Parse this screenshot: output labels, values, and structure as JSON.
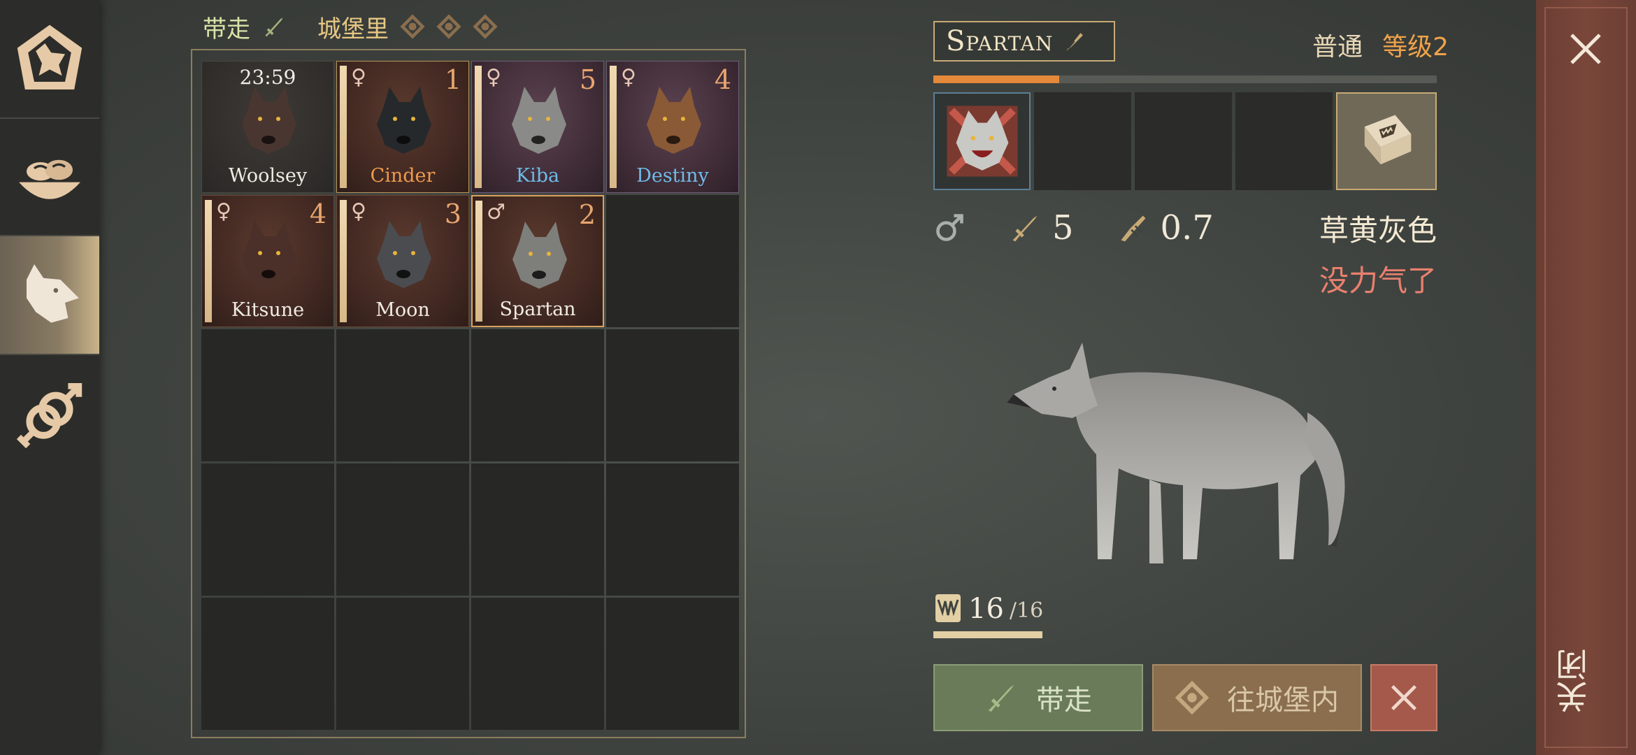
{
  "sidebar": {
    "tabs": [
      {
        "icon": "wolf-emblem-icon"
      },
      {
        "icon": "food-bowl-icon"
      },
      {
        "icon": "wolf-head-icon",
        "active": true
      },
      {
        "icon": "breeding-gender-icon"
      }
    ]
  },
  "header": {
    "take_label": "带走",
    "castle_label": "城堡里"
  },
  "grid": {
    "cells": [
      {
        "timer": "23:59",
        "name": "Woolsey",
        "level": ""
      },
      {
        "sex": "♀",
        "level": "1",
        "name": "Cinder"
      },
      {
        "sex": "♀",
        "level": "5",
        "name": "Kiba"
      },
      {
        "sex": "♀",
        "level": "4",
        "name": "Destiny"
      },
      {
        "sex": "♀",
        "level": "4",
        "name": "Kitsune"
      },
      {
        "sex": "♀",
        "level": "3",
        "name": "Moon"
      },
      {
        "sex": "♂",
        "level": "2",
        "name": "Spartan"
      }
    ]
  },
  "detail": {
    "name": "Spartan",
    "rarity": "普通",
    "level": "等级2",
    "xp_progress": 0.25,
    "sex": "♂",
    "attack": "5",
    "speed": "0.7",
    "color_name": "草黄灰色",
    "status": "没力气了",
    "fang_current": "16",
    "fang_max": "/16"
  },
  "buttons": {
    "take": "带走",
    "move_to_castle": "往城堡内",
    "close": "关闭"
  }
}
